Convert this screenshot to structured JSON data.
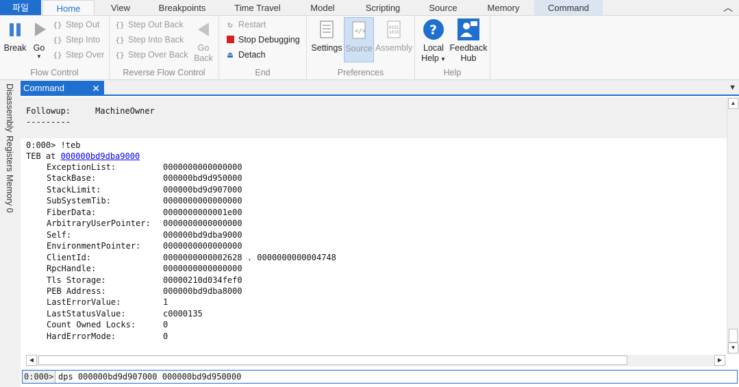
{
  "tabs": {
    "file": "파일",
    "home": "Home",
    "view": "View",
    "breakpoints": "Breakpoints",
    "time_travel": "Time Travel",
    "model": "Model",
    "scripting": "Scripting",
    "source": "Source",
    "memory": "Memory",
    "command": "Command"
  },
  "ribbon": {
    "flow_control": {
      "label": "Flow Control",
      "break": "Break",
      "go": "Go",
      "step_out": "Step Out",
      "step_into": "Step Into",
      "step_over": "Step Over"
    },
    "reverse_flow_control": {
      "label": "Reverse Flow Control",
      "step_out_back": "Step Out Back",
      "step_into_back": "Step Into Back",
      "step_over_back": "Step Over Back",
      "go_back_1": "Go",
      "go_back_2": "Back"
    },
    "end": {
      "label": "End",
      "restart": "Restart",
      "stop_debugging": "Stop Debugging",
      "detach": "Detach"
    },
    "preferences": {
      "label": "Preferences",
      "settings": "Settings",
      "source": "Source",
      "assembly": "Assembly"
    },
    "help": {
      "label": "Help",
      "local_help_1": "Local",
      "local_help_2": "Help",
      "feedback_1": "Feedback",
      "feedback_2": "Hub"
    }
  },
  "side_tabs": [
    "Disassembly",
    "Registers",
    "Memory 0"
  ],
  "command_window": {
    "title": "Command",
    "prev_lines": [
      "Followup:     MachineOwner",
      "---------"
    ],
    "prompt_line": "0:000> !teb",
    "teb_prefix": "TEB at ",
    "teb_address": "000000bd9dba9000",
    "fields": [
      {
        "name": "ExceptionList:",
        "value": "0000000000000000"
      },
      {
        "name": "StackBase:",
        "value": "000000bd9d950000"
      },
      {
        "name": "StackLimit:",
        "value": "000000bd9d907000"
      },
      {
        "name": "SubSystemTib:",
        "value": "0000000000000000"
      },
      {
        "name": "FiberData:",
        "value": "0000000000001e00"
      },
      {
        "name": "ArbitraryUserPointer:",
        "value": "0000000000000000"
      },
      {
        "name": "Self:",
        "value": "000000bd9dba9000"
      },
      {
        "name": "EnvironmentPointer:",
        "value": "0000000000000000"
      },
      {
        "name": "ClientId:",
        "value": "0000000000002628 . 0000000000004748"
      },
      {
        "name": "RpcHandle:",
        "value": "0000000000000000"
      },
      {
        "name": "Tls Storage:",
        "value": "00000210d034fef0"
      },
      {
        "name": "PEB Address:",
        "value": "000000bd9dba8000"
      },
      {
        "name": "LastErrorValue:",
        "value": "1"
      },
      {
        "name": "LastStatusValue:",
        "value": "c0000135"
      },
      {
        "name": "Count Owned Locks:",
        "value": "0"
      },
      {
        "name": "HardErrorMode:",
        "value": "0"
      }
    ],
    "input_prompt": "0:000>",
    "input_value": "dps 000000bd9d907000 000000bd9d950000"
  },
  "colors": {
    "accent": "#1e6fd0",
    "stop_red": "#d81e1e"
  }
}
